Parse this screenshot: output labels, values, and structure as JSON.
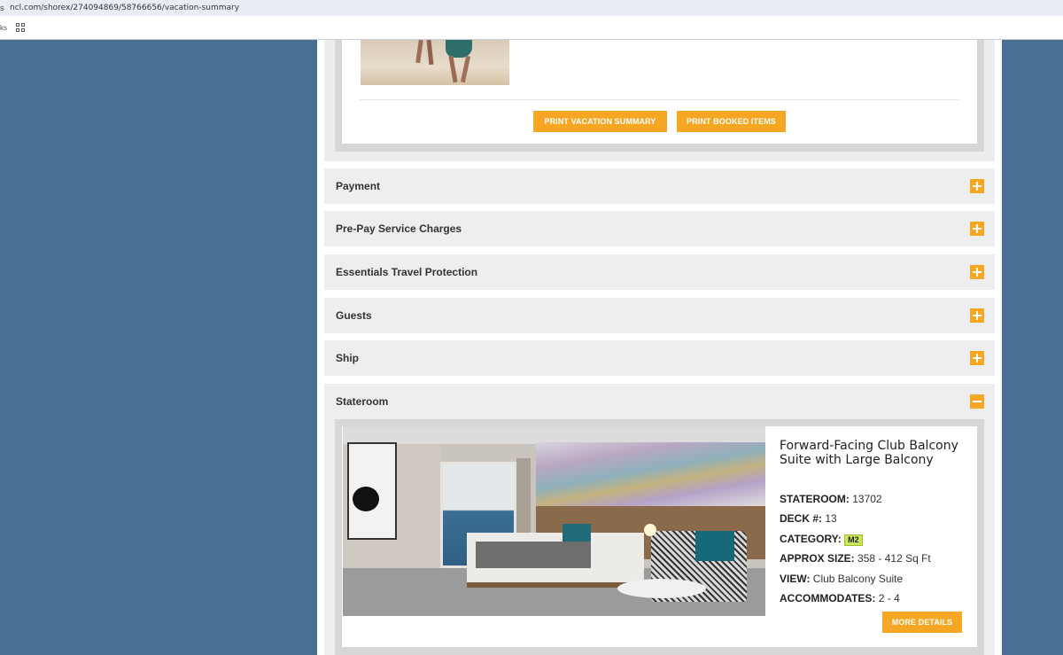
{
  "browser": {
    "url": "ncl.com/shorex/274094869/58766656/vacation-summary",
    "lead_glyph": "s",
    "bookmarks_lead": "ks"
  },
  "summary": {
    "print_summary_label": "PRINT VACATION SUMMARY",
    "print_booked_label": "PRINT BOOKED ITEMS"
  },
  "accordion": [
    {
      "title": "Payment",
      "state": "collapsed"
    },
    {
      "title": "Pre-Pay Service Charges",
      "state": "collapsed"
    },
    {
      "title": "Essentials Travel Protection",
      "state": "collapsed"
    },
    {
      "title": "Guests",
      "state": "collapsed"
    },
    {
      "title": "Ship",
      "state": "collapsed"
    },
    {
      "title": "Stateroom",
      "state": "expanded"
    }
  ],
  "stateroom": {
    "title": "Forward-Facing Club Balcony Suite with Large Balcony",
    "stateroom_label": "STATEROOM:",
    "stateroom_value": "13702",
    "deck_label": "DECK #:",
    "deck_value": "13",
    "category_label": "CATEGORY:",
    "category_value": "M2",
    "size_label": "APPROX SIZE:",
    "size_value": "358 - 412 Sq Ft",
    "view_label": "VIEW:",
    "view_value": "Club Balcony Suite",
    "accommodates_label": "ACCOMMODATES:",
    "accommodates_value": "2 - 4",
    "more_details_label": "MORE DETAILS"
  },
  "colors": {
    "accent": "#f5a623",
    "background": "#4a6f95",
    "category_badge": "#c9e85b"
  },
  "icons": {
    "apps": "apps-grid-icon",
    "expand": "plus-icon",
    "collapse": "minus-icon"
  }
}
